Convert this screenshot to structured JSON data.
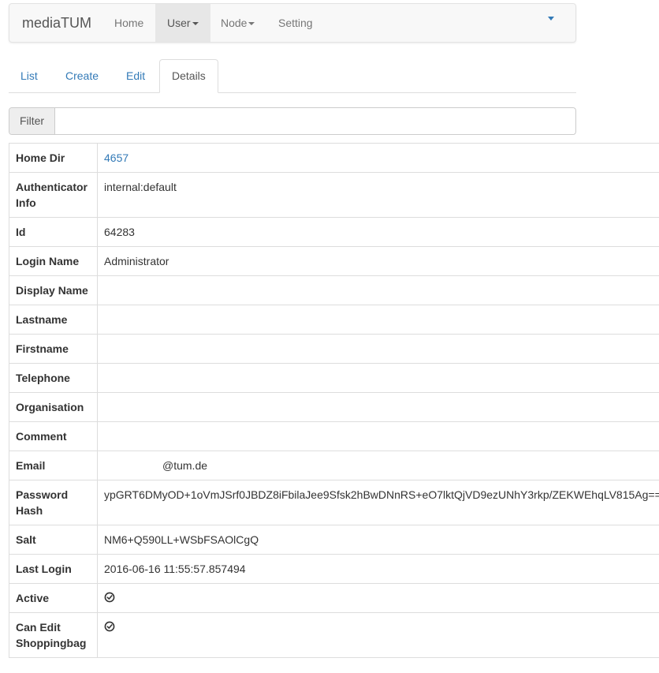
{
  "navbar": {
    "brand": "mediaTUM",
    "items": [
      {
        "label": "Home"
      },
      {
        "label": "User"
      },
      {
        "label": "Node"
      },
      {
        "label": "Setting"
      }
    ]
  },
  "tabs": [
    {
      "label": "List"
    },
    {
      "label": "Create"
    },
    {
      "label": "Edit"
    },
    {
      "label": "Details",
      "active": true
    }
  ],
  "filter": {
    "label": "Filter",
    "value": ""
  },
  "details": [
    {
      "key": "Home Dir",
      "value": "4657",
      "link": true
    },
    {
      "key": "Authenticator Info",
      "value": "internal:default"
    },
    {
      "key": "Id",
      "value": "64283"
    },
    {
      "key": "Login Name",
      "value": "Administrator"
    },
    {
      "key": "Display Name",
      "value": ""
    },
    {
      "key": "Lastname",
      "value": ""
    },
    {
      "key": "Firstname",
      "value": ""
    },
    {
      "key": "Telephone",
      "value": ""
    },
    {
      "key": "Organisation",
      "value": ""
    },
    {
      "key": "Comment",
      "value": ""
    },
    {
      "key": "Email",
      "value": "@tum.de"
    },
    {
      "key": "Password Hash",
      "value": "ypGRT6DMyOD+1oVmJSrf0JBDZ8iFbilaJee9Sfsk2hBwDNnRS+eO7lktQjVD9ezUNhY3rkp/ZEKWEhqLV815Ag=="
    },
    {
      "key": "Salt",
      "value": "NM6+Q590LL+WSbFSAOlCgQ"
    },
    {
      "key": "Last Login",
      "value": "2016-06-16 11:55:57.857494"
    },
    {
      "key": "Active",
      "icon": "check-circle-icon"
    },
    {
      "key": "Can Edit Shoppingbag",
      "icon": "check-circle-icon"
    }
  ],
  "colors": {
    "link": "#337ab7",
    "navbar_bg": "#f8f8f8",
    "active_nav": "#e7e7e7",
    "border": "#dddddd"
  }
}
